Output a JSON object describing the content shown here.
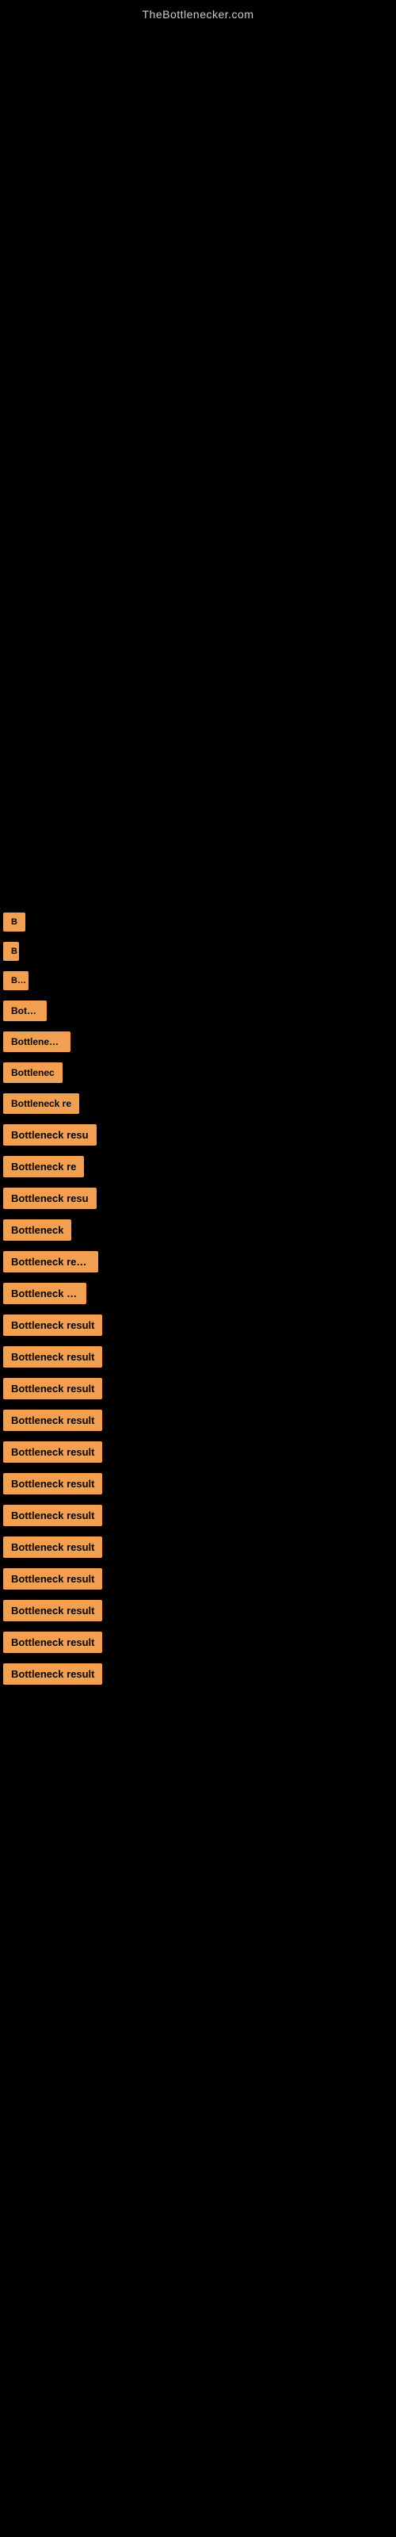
{
  "site": {
    "title": "TheBottlenecker.com"
  },
  "results": {
    "items": [
      {
        "label": "B",
        "id": 1
      },
      {
        "label": "B",
        "id": 2
      },
      {
        "label": "Bo",
        "id": 3
      },
      {
        "label": "Bottlen",
        "id": 4
      },
      {
        "label": "Bottleneck r",
        "id": 5
      },
      {
        "label": "Bottlenec",
        "id": 6
      },
      {
        "label": "Bottleneck re",
        "id": 7
      },
      {
        "label": "Bottleneck resu",
        "id": 8
      },
      {
        "label": "Bottleneck re",
        "id": 9
      },
      {
        "label": "Bottleneck resu",
        "id": 10
      },
      {
        "label": "Bottleneck",
        "id": 11
      },
      {
        "label": "Bottleneck result",
        "id": 12
      },
      {
        "label": "Bottleneck res",
        "id": 13
      },
      {
        "label": "Bottleneck result",
        "id": 14
      },
      {
        "label": "Bottleneck result",
        "id": 15
      },
      {
        "label": "Bottleneck result",
        "id": 16
      },
      {
        "label": "Bottleneck result",
        "id": 17
      },
      {
        "label": "Bottleneck result",
        "id": 18
      },
      {
        "label": "Bottleneck result",
        "id": 19
      },
      {
        "label": "Bottleneck result",
        "id": 20
      },
      {
        "label": "Bottleneck result",
        "id": 21
      },
      {
        "label": "Bottleneck result",
        "id": 22
      },
      {
        "label": "Bottleneck result",
        "id": 23
      },
      {
        "label": "Bottleneck result",
        "id": 24
      },
      {
        "label": "Bottleneck result",
        "id": 25
      }
    ]
  }
}
